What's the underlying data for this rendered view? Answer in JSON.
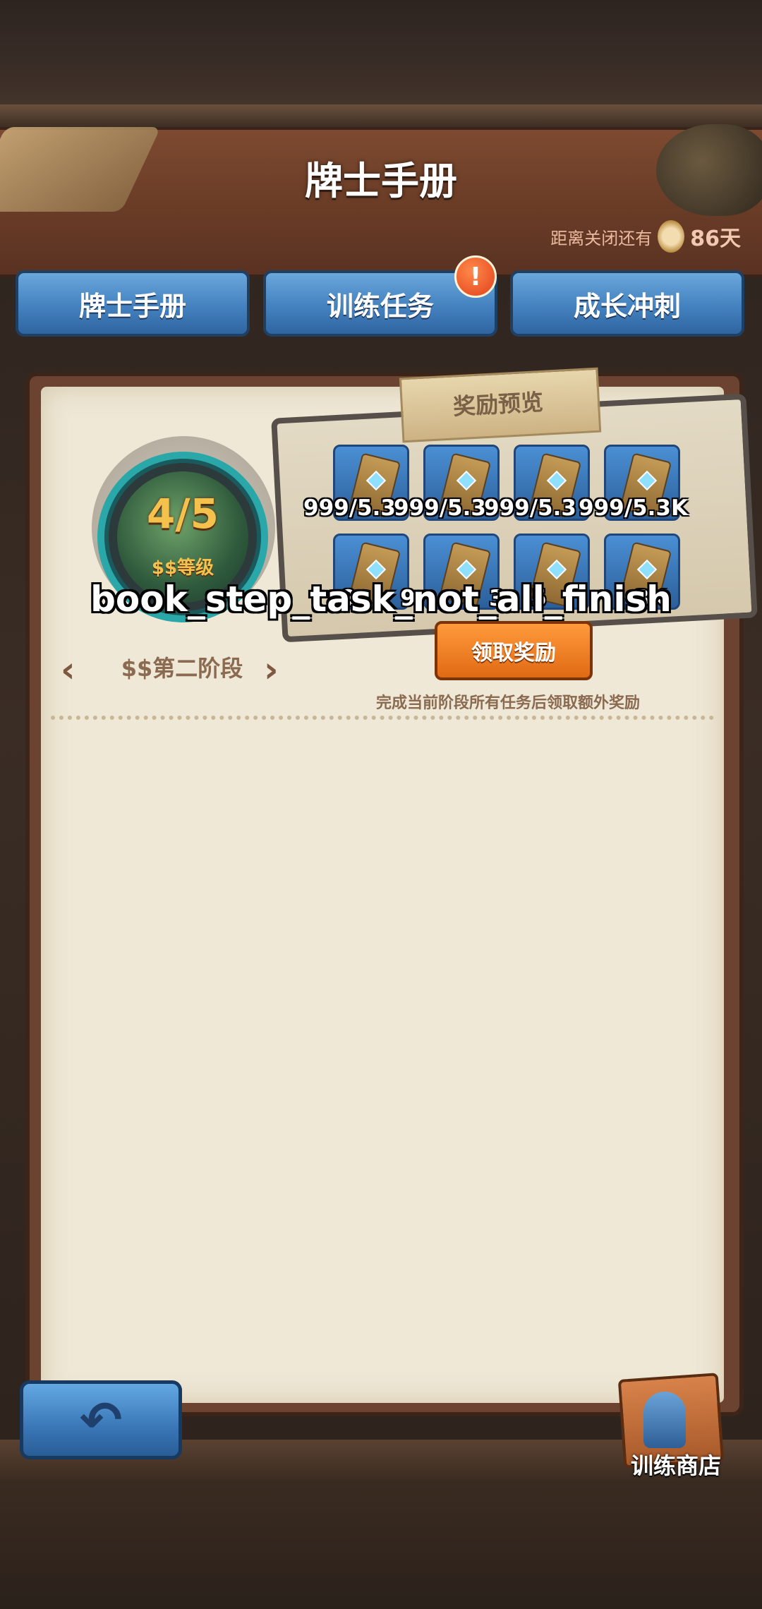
{
  "header": {
    "title": "牌士手册"
  },
  "countdown": {
    "prefix": "距离关闭还有",
    "days": "86天"
  },
  "tabs": [
    {
      "label": "牌士手册"
    },
    {
      "label": "训练任务",
      "badge": "!"
    },
    {
      "label": "成长冲刺"
    }
  ],
  "level": {
    "value": "4/5",
    "label": "$$等级"
  },
  "stage": {
    "label": "$$第二阶段"
  },
  "reward_preview": {
    "title": "奖励预览",
    "items_row1": [
      "999/5.3",
      "999/5.3",
      "999/5.3",
      "999/5.3K"
    ],
    "items_row2": [
      "9",
      "9",
      "3",
      "5",
      "3K"
    ]
  },
  "overlay_text": "book_step_task_not_all_finish",
  "claim_button": "领取奖励",
  "hint": "完成当前阶段所有任务后领取额外奖励",
  "shop": {
    "label": "训练商店"
  },
  "colors": {
    "tab_blue": "#4482bf",
    "claim_orange": "#e06a14",
    "level_gold": "#f4c24c"
  }
}
